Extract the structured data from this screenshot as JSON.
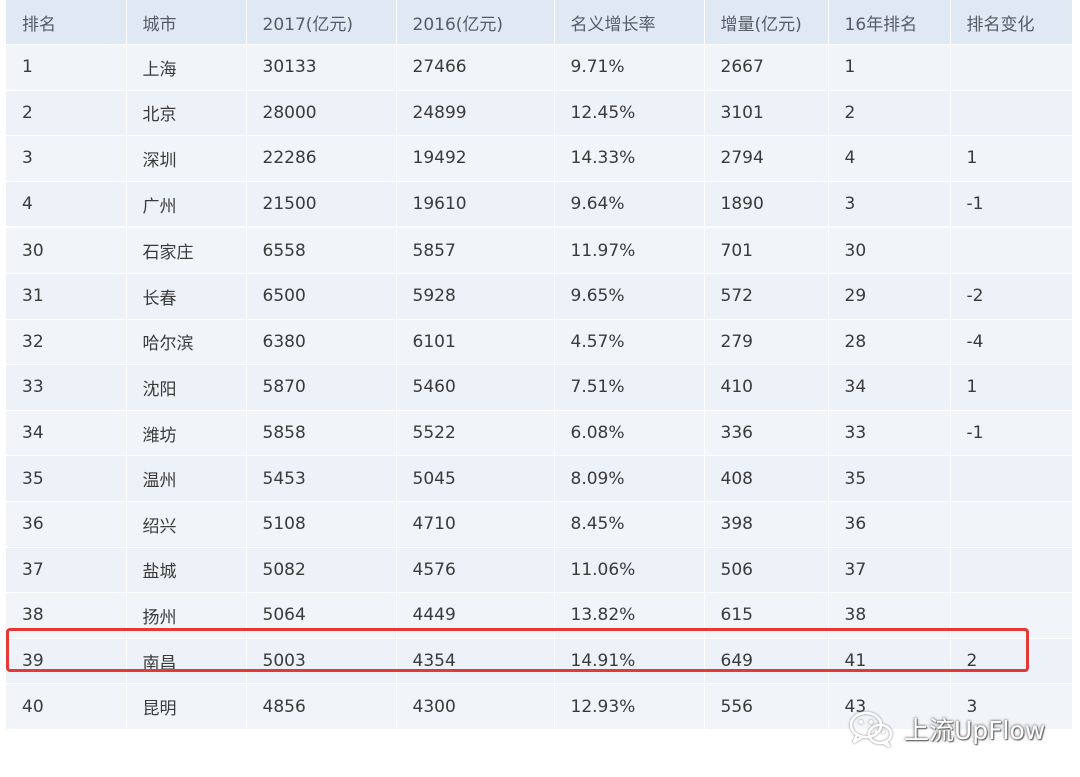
{
  "chart_data": {
    "type": "table",
    "columns": [
      "排名",
      "城市",
      "2017(亿元)",
      "2016(亿元)",
      "名义增长率",
      "增量(亿元)",
      "16年排名",
      "排名变化"
    ],
    "rows": [
      [
        "1",
        "上海",
        "30133",
        "27466",
        "9.71%",
        "2667",
        "1",
        ""
      ],
      [
        "2",
        "北京",
        "28000",
        "24899",
        "12.45%",
        "3101",
        "2",
        ""
      ],
      [
        "3",
        "深圳",
        "22286",
        "19492",
        "14.33%",
        "2794",
        "4",
        "1"
      ],
      [
        "4",
        "广州",
        "21500",
        "19610",
        "9.64%",
        "1890",
        "3",
        "-1"
      ],
      [
        "30",
        "石家庄",
        "6558",
        "5857",
        "11.97%",
        "701",
        "30",
        ""
      ],
      [
        "31",
        "长春",
        "6500",
        "5928",
        "9.65%",
        "572",
        "29",
        "-2"
      ],
      [
        "32",
        "哈尔滨",
        "6380",
        "6101",
        "4.57%",
        "279",
        "28",
        "-4"
      ],
      [
        "33",
        "沈阳",
        "5870",
        "5460",
        "7.51%",
        "410",
        "34",
        "1"
      ],
      [
        "34",
        "潍坊",
        "5858",
        "5522",
        "6.08%",
        "336",
        "33",
        "-1"
      ],
      [
        "35",
        "温州",
        "5453",
        "5045",
        "8.09%",
        "408",
        "35",
        ""
      ],
      [
        "36",
        "绍兴",
        "5108",
        "4710",
        "8.45%",
        "398",
        "36",
        ""
      ],
      [
        "37",
        "盐城",
        "5082",
        "4576",
        "11.06%",
        "506",
        "37",
        ""
      ],
      [
        "38",
        "扬州",
        "5064",
        "4449",
        "13.82%",
        "615",
        "38",
        ""
      ],
      [
        "39",
        "南昌",
        "5003",
        "4354",
        "14.91%",
        "649",
        "41",
        "2"
      ],
      [
        "40",
        "昆明",
        "4856",
        "4300",
        "12.93%",
        "556",
        "43",
        "3"
      ]
    ],
    "highlighted_row": "39"
  },
  "colors": {
    "header_bg": "#dfe8f3",
    "row_bg": "#f1f5fa",
    "highlight": "#e53935"
  },
  "watermark": {
    "text": "上流UpFlow",
    "icon": "wechat-icon"
  }
}
